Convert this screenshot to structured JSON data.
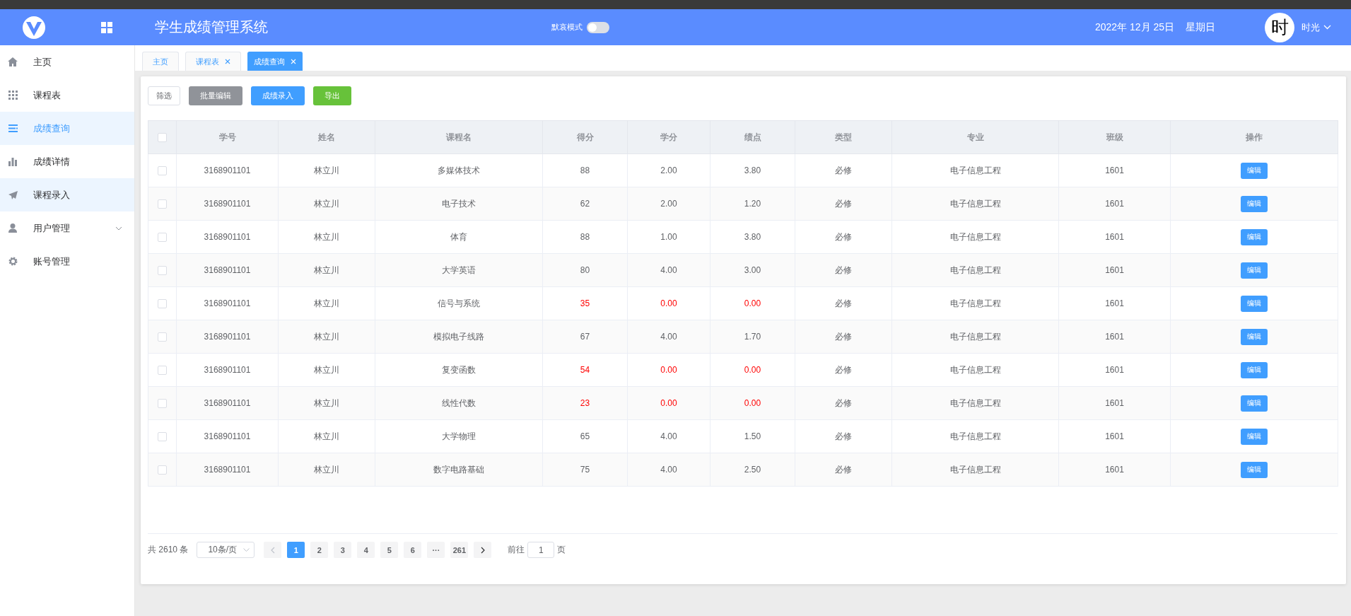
{
  "header": {
    "title": "学生成绩管理系统",
    "mode_label": "默哀模式",
    "mode_on": false,
    "date": "2022年 12月 25日",
    "weekday": "星期日",
    "avatar": "时",
    "user": "时光"
  },
  "sidebar": {
    "items": [
      {
        "label": "主页",
        "kind": "home",
        "selected": false,
        "hovered": false
      },
      {
        "label": "课程表",
        "kind": "grid",
        "selected": false,
        "hovered": false
      },
      {
        "label": "成绩查询",
        "kind": "list",
        "selected": true,
        "hovered": false
      },
      {
        "label": "成绩详情",
        "kind": "chart",
        "selected": false,
        "hovered": false
      },
      {
        "label": "课程录入",
        "kind": "send",
        "selected": false,
        "hovered": true
      },
      {
        "label": "用户管理",
        "kind": "user",
        "selected": false,
        "hovered": false,
        "expanded": false
      },
      {
        "label": "账号管理",
        "kind": "gear",
        "selected": false,
        "hovered": false
      }
    ]
  },
  "tabs": [
    {
      "label": "主页",
      "selected": false,
      "closable": false
    },
    {
      "label": "课程表",
      "selected": false,
      "closable": true
    },
    {
      "label": "成绩查询",
      "selected": true,
      "closable": true
    }
  ],
  "toolbar": [
    {
      "label": "筛选",
      "kind": "plain"
    },
    {
      "label": "批量编辑",
      "kind": "gray"
    },
    {
      "label": "成绩录入",
      "kind": "primary"
    },
    {
      "label": "导出",
      "kind": "success"
    }
  ],
  "table": {
    "header_checked": false,
    "columns": [
      "学号",
      "姓名",
      "课程名",
      "得分",
      "学分",
      "绩点",
      "类型",
      "专业",
      "班级",
      "操作"
    ],
    "rows": [
      {
        "checked": false,
        "failed": false,
        "cells": [
          "3168901101",
          "林立川",
          "多媒体技术",
          "88",
          "2.00",
          "3.80",
          "必修",
          "电子信息工程",
          "1601"
        ],
        "action": "编辑"
      },
      {
        "checked": false,
        "failed": false,
        "cells": [
          "3168901101",
          "林立川",
          "电子技术",
          "62",
          "2.00",
          "1.20",
          "必修",
          "电子信息工程",
          "1601"
        ],
        "action": "编辑"
      },
      {
        "checked": false,
        "failed": false,
        "cells": [
          "3168901101",
          "林立川",
          "体育",
          "88",
          "1.00",
          "3.80",
          "必修",
          "电子信息工程",
          "1601"
        ],
        "action": "编辑"
      },
      {
        "checked": false,
        "failed": false,
        "cells": [
          "3168901101",
          "林立川",
          "大学英语",
          "80",
          "4.00",
          "3.00",
          "必修",
          "电子信息工程",
          "1601"
        ],
        "action": "编辑"
      },
      {
        "checked": false,
        "failed": true,
        "cells": [
          "3168901101",
          "林立川",
          "信号与系统",
          "35",
          "0.00",
          "0.00",
          "必修",
          "电子信息工程",
          "1601"
        ],
        "action": "编辑"
      },
      {
        "checked": false,
        "failed": false,
        "cells": [
          "3168901101",
          "林立川",
          "模拟电子线路",
          "67",
          "4.00",
          "1.70",
          "必修",
          "电子信息工程",
          "1601"
        ],
        "action": "编辑"
      },
      {
        "checked": false,
        "failed": true,
        "cells": [
          "3168901101",
          "林立川",
          "复变函数",
          "54",
          "0.00",
          "0.00",
          "必修",
          "电子信息工程",
          "1601"
        ],
        "action": "编辑"
      },
      {
        "checked": false,
        "failed": true,
        "cells": [
          "3168901101",
          "林立川",
          "线性代数",
          "23",
          "0.00",
          "0.00",
          "必修",
          "电子信息工程",
          "1601"
        ],
        "action": "编辑"
      },
      {
        "checked": false,
        "failed": false,
        "cells": [
          "3168901101",
          "林立川",
          "大学物理",
          "65",
          "4.00",
          "1.50",
          "必修",
          "电子信息工程",
          "1601"
        ],
        "action": "编辑"
      },
      {
        "checked": false,
        "failed": false,
        "cells": [
          "3168901101",
          "林立川",
          "数字电路基础",
          "75",
          "4.00",
          "2.50",
          "必修",
          "电子信息工程",
          "1601"
        ],
        "action": "编辑"
      }
    ]
  },
  "pagination": {
    "total": "共 2610 条",
    "page_size": "10条/页",
    "prev_disabled": true,
    "next_disabled": false,
    "pages": [
      {
        "label": "1",
        "selected": true
      },
      {
        "label": "2",
        "selected": false
      },
      {
        "label": "3",
        "selected": false
      },
      {
        "label": "4",
        "selected": false
      },
      {
        "label": "5",
        "selected": false
      },
      {
        "label": "6",
        "selected": false
      },
      {
        "label": "···",
        "selected": false
      },
      {
        "label": "261",
        "selected": false
      }
    ],
    "goto_label": "前往",
    "goto_value": "1",
    "page_suffix": "页"
  }
}
